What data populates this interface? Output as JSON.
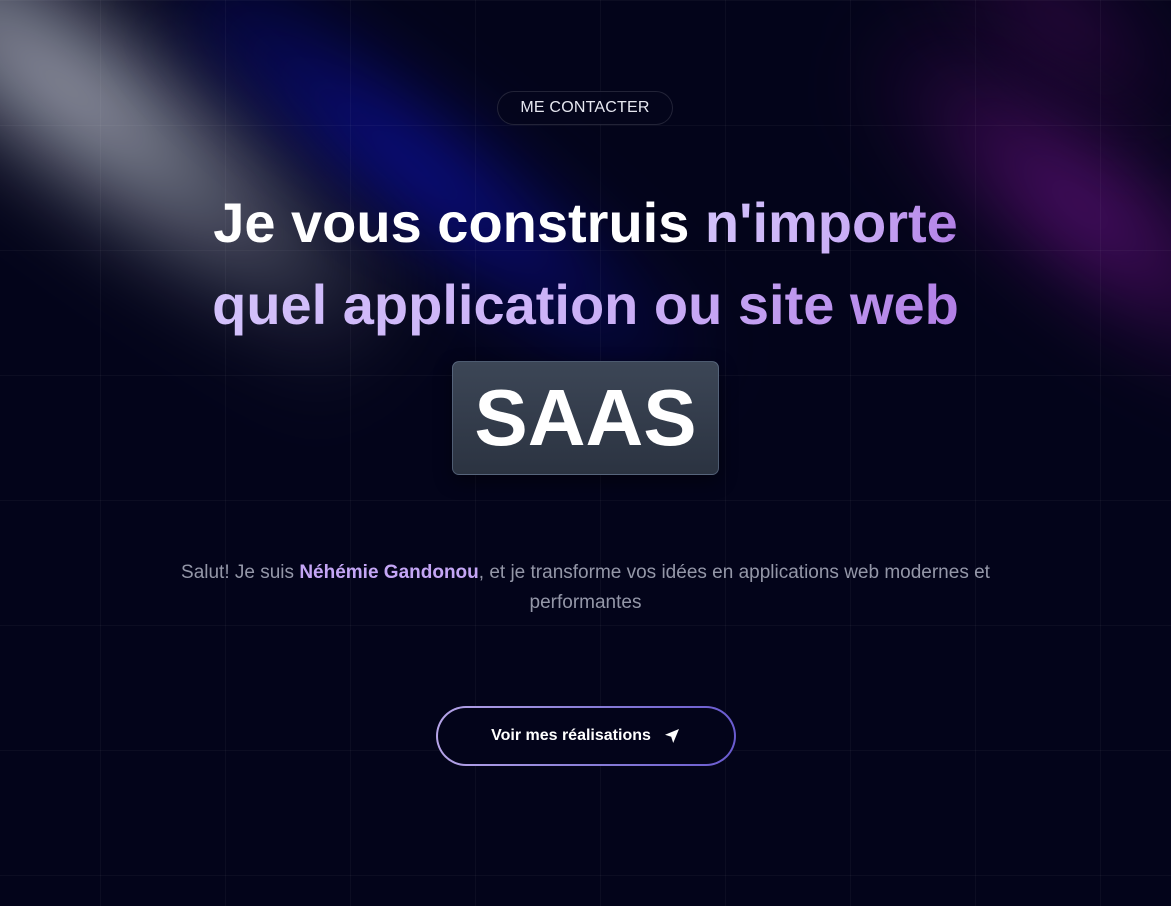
{
  "contact": {
    "label": "ME CONTACTER"
  },
  "hero": {
    "headline_white": "Je vous construis ",
    "headline_accent_line1": "n'importe",
    "headline_accent_line2": "quel application ou site web",
    "rotating_word": "SAAS"
  },
  "intro": {
    "prefix": "Salut! Je suis ",
    "name": "Néhémie Gandonou",
    "suffix": ", et je transforme vos idées en applications web modernes et performantes"
  },
  "cta": {
    "label": "Voir mes réalisations",
    "icon": "send-arrow-icon"
  },
  "colors": {
    "background": "#03041a",
    "accent_purple": "#c4a6f5",
    "saas_box": "#323b4a"
  }
}
